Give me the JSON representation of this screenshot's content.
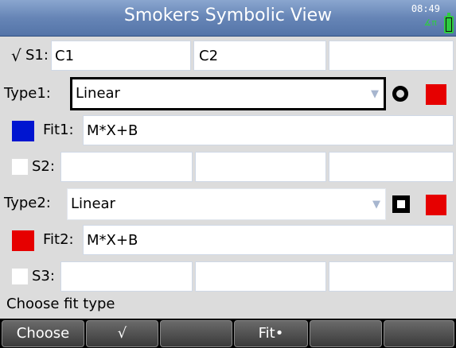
{
  "title": "Smokers Symbolic View",
  "status_bar": {
    "time": "08:49",
    "angle_mode": "∡π"
  },
  "rows": {
    "s1": {
      "check": "√",
      "label": "S1:",
      "col_x": "C1",
      "col_y": "C2",
      "col_z": "",
      "checked": true
    },
    "type1": {
      "label": "Type1:",
      "value": "Linear",
      "dropdown_arrow": "▼",
      "marker": "ring",
      "color": "#e60000"
    },
    "fit1": {
      "label": "Fit1:",
      "value": "M*X+B",
      "color": "#0015d0"
    },
    "s2": {
      "label": "S2:",
      "col_x": "",
      "col_y": "",
      "col_z": "",
      "checked": false
    },
    "type2": {
      "label": "Type2:",
      "value": "Linear",
      "dropdown_arrow": "▼",
      "marker": "square",
      "color": "#e60000"
    },
    "fit2": {
      "label": "Fit2:",
      "value": "M*X+B",
      "color": "#e60000"
    },
    "s3": {
      "label": "S3:",
      "col_x": "",
      "col_y": "",
      "col_z": "",
      "checked": false
    }
  },
  "status_message": "Choose fit type",
  "menu": [
    "Choose",
    "√",
    "",
    "Fit•",
    "",
    ""
  ]
}
